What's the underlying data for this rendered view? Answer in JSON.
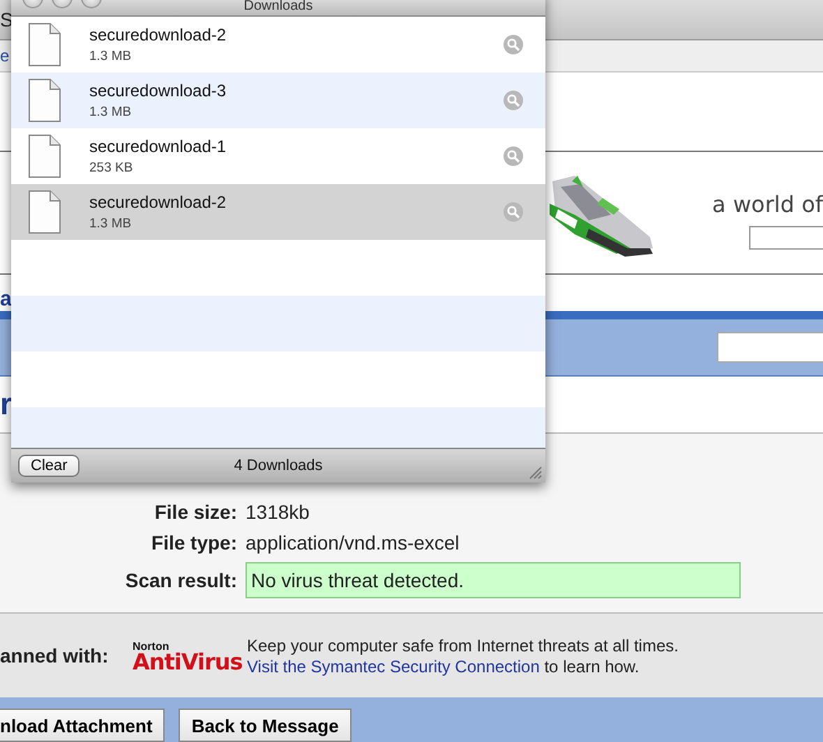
{
  "page": {
    "edge_fragments": [
      {
        "text": "S",
        "kind": "tab"
      },
      {
        "text": "e",
        "kind": "link"
      }
    ],
    "banner": {
      "tagline": "a world of"
    },
    "nav": {
      "fragment": "a"
    },
    "heading_fragment": "r",
    "details": [
      {
        "label": "File size:",
        "value": "1318kb",
        "kind": "plain"
      },
      {
        "label": "File type:",
        "value": "application/vnd.ms-excel",
        "kind": "plain"
      },
      {
        "label": "Scan result:",
        "value": "No virus threat detected.",
        "kind": "ok"
      }
    ],
    "scanner": {
      "label": "anned with:",
      "brand_small": "Norton",
      "brand": "AntiVirus",
      "message": "Keep your computer safe from Internet threats at all times.",
      "link": "Visit the Symantec Security Connection",
      "link_after": " to learn how."
    },
    "buttons": [
      "nload Attachment",
      "Back to Message"
    ]
  },
  "downloads": {
    "title": "Downloads",
    "items": [
      {
        "name": "securedownload-2",
        "size": "1.3 MB",
        "selected": false
      },
      {
        "name": "securedownload-3",
        "size": "1.3 MB",
        "selected": false
      },
      {
        "name": "securedownload-1",
        "size": "253 KB",
        "selected": false
      },
      {
        "name": "securedownload-2",
        "size": "1.3 MB",
        "selected": true
      }
    ],
    "clear_button": "Clear",
    "status": "4 Downloads"
  }
}
